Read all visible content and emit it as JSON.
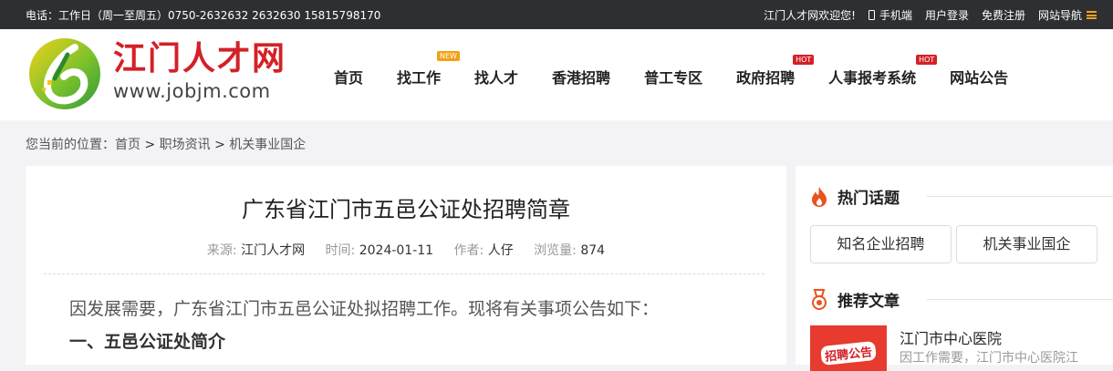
{
  "topbar": {
    "contact": "电话：工作日（周一至周五）0750-2632632 2632630 15815798170",
    "welcome": "江门人才网欢迎您!",
    "mobile": "手机端",
    "login": "用户登录",
    "register": "免费注册",
    "site_nav": "网站导航"
  },
  "logo": {
    "name": "江门人才网",
    "url": "www.jobjm.com",
    "colors": {
      "green": "#6fbf2c",
      "yellow": "#f2c31a",
      "red": "#d42027"
    }
  },
  "nav": {
    "items": [
      {
        "label": "首页"
      },
      {
        "label": "找工作",
        "badge": "NEW"
      },
      {
        "label": "找人才"
      },
      {
        "label": "香港招聘"
      },
      {
        "label": "普工专区"
      },
      {
        "label": "政府招聘",
        "badge": "HOT"
      },
      {
        "label": "人事报考系统",
        "badge": "HOT"
      },
      {
        "label": "网站公告"
      }
    ]
  },
  "breadcrumb": {
    "prefix": "您当前的位置：",
    "items": [
      "首页",
      "职场资讯",
      "机关事业国企"
    ],
    "sep": " > "
  },
  "article": {
    "title": "广东省江门市五邑公证处招聘简章",
    "meta": {
      "source_label": "来源:",
      "source": "江门人才网",
      "time_label": "时间:",
      "time": "2024-01-11",
      "author_label": "作者:",
      "author": "人仔",
      "views_label": "浏览量:",
      "views": "874"
    },
    "paragraph": "因发展需要，广东省江门市五邑公证处拟招聘工作。现将有关事项公告如下：",
    "heading1": "一、五邑公证处简介"
  },
  "sidebar": {
    "hot_title": "热门话题",
    "tags": [
      "知名企业招聘",
      "机关事业国企"
    ],
    "rec_title": "推荐文章",
    "rec_item": {
      "thumb_label": "招聘公告",
      "title": "江门市中心医院",
      "desc": "因工作需要，江门市中心医院江"
    },
    "accent": "#e8541e"
  }
}
